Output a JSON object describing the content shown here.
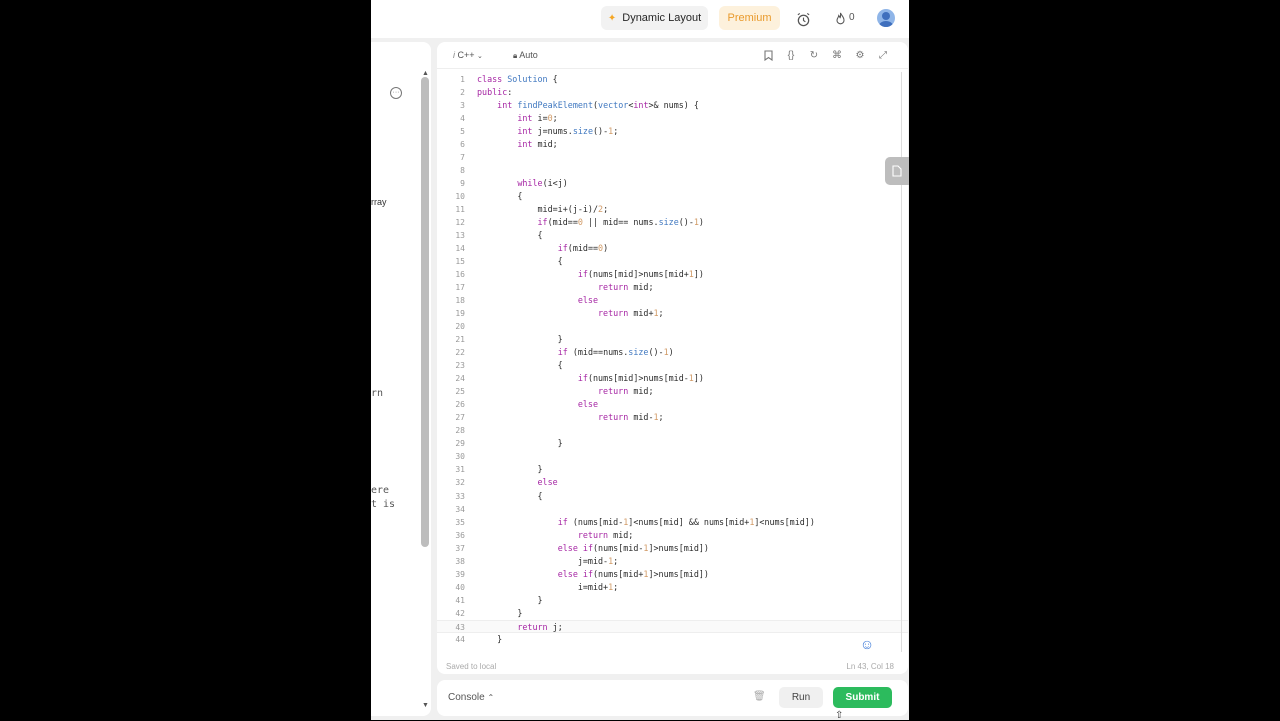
{
  "topbar": {
    "dynamic_layout": "Dynamic Layout",
    "premium": "Premium",
    "streak_count": "0"
  },
  "left_panel": {
    "fragments": [
      "rray",
      "rn",
      "ere",
      "t is"
    ]
  },
  "editor": {
    "language": "C++",
    "auto_label": "Auto",
    "saved_status": "Saved to local",
    "cursor_position": "Ln 43, Col 18",
    "lines": [
      {
        "num": "1",
        "text": "class Solution {"
      },
      {
        "num": "2",
        "text": "public:"
      },
      {
        "num": "3",
        "text": "    int findPeakElement(vector<int>& nums) {"
      },
      {
        "num": "4",
        "text": "        int i=0;"
      },
      {
        "num": "5",
        "text": "        int j=nums.size()-1;"
      },
      {
        "num": "6",
        "text": "        int mid;"
      },
      {
        "num": "7",
        "text": ""
      },
      {
        "num": "8",
        "text": ""
      },
      {
        "num": "9",
        "text": "        while(i<j)"
      },
      {
        "num": "10",
        "text": "        {"
      },
      {
        "num": "11",
        "text": "            mid=i+(j-i)/2;"
      },
      {
        "num": "12",
        "text": "            if(mid==0 || mid== nums.size()-1)"
      },
      {
        "num": "13",
        "text": "            {"
      },
      {
        "num": "14",
        "text": "                if(mid==0)"
      },
      {
        "num": "15",
        "text": "                {"
      },
      {
        "num": "16",
        "text": "                    if(nums[mid]>nums[mid+1])"
      },
      {
        "num": "17",
        "text": "                        return mid;"
      },
      {
        "num": "18",
        "text": "                    else"
      },
      {
        "num": "19",
        "text": "                        return mid+1;"
      },
      {
        "num": "20",
        "text": ""
      },
      {
        "num": "21",
        "text": "                }"
      },
      {
        "num": "22",
        "text": "                if (mid==nums.size()-1)"
      },
      {
        "num": "23",
        "text": "                {"
      },
      {
        "num": "24",
        "text": "                    if(nums[mid]>nums[mid-1])"
      },
      {
        "num": "25",
        "text": "                        return mid;"
      },
      {
        "num": "26",
        "text": "                    else"
      },
      {
        "num": "27",
        "text": "                        return mid-1;"
      },
      {
        "num": "28",
        "text": ""
      },
      {
        "num": "29",
        "text": "                }"
      },
      {
        "num": "30",
        "text": ""
      },
      {
        "num": "31",
        "text": "            }"
      },
      {
        "num": "32",
        "text": "            else"
      },
      {
        "num": "33",
        "text": "            {"
      },
      {
        "num": "34",
        "text": ""
      },
      {
        "num": "35",
        "text": "                if (nums[mid-1]<nums[mid] && nums[mid+1]<nums[mid])"
      },
      {
        "num": "36",
        "text": "                    return mid;"
      },
      {
        "num": "37",
        "text": "                else if(nums[mid-1]>nums[mid])"
      },
      {
        "num": "38",
        "text": "                    j=mid-1;"
      },
      {
        "num": "39",
        "text": "                else if(nums[mid+1]>nums[mid])"
      },
      {
        "num": "40",
        "text": "                    i=mid+1;"
      },
      {
        "num": "41",
        "text": "            }"
      },
      {
        "num": "42",
        "text": "        }"
      },
      {
        "num": "43",
        "text": "        return j;"
      },
      {
        "num": "44",
        "text": "    }"
      }
    ]
  },
  "bottom_bar": {
    "console_label": "Console",
    "run_label": "Run",
    "submit_label": "Submit"
  },
  "colors": {
    "submit": "#2cbb5d",
    "premium_bg": "#fdf1dc",
    "premium_text": "#e99a2c"
  }
}
